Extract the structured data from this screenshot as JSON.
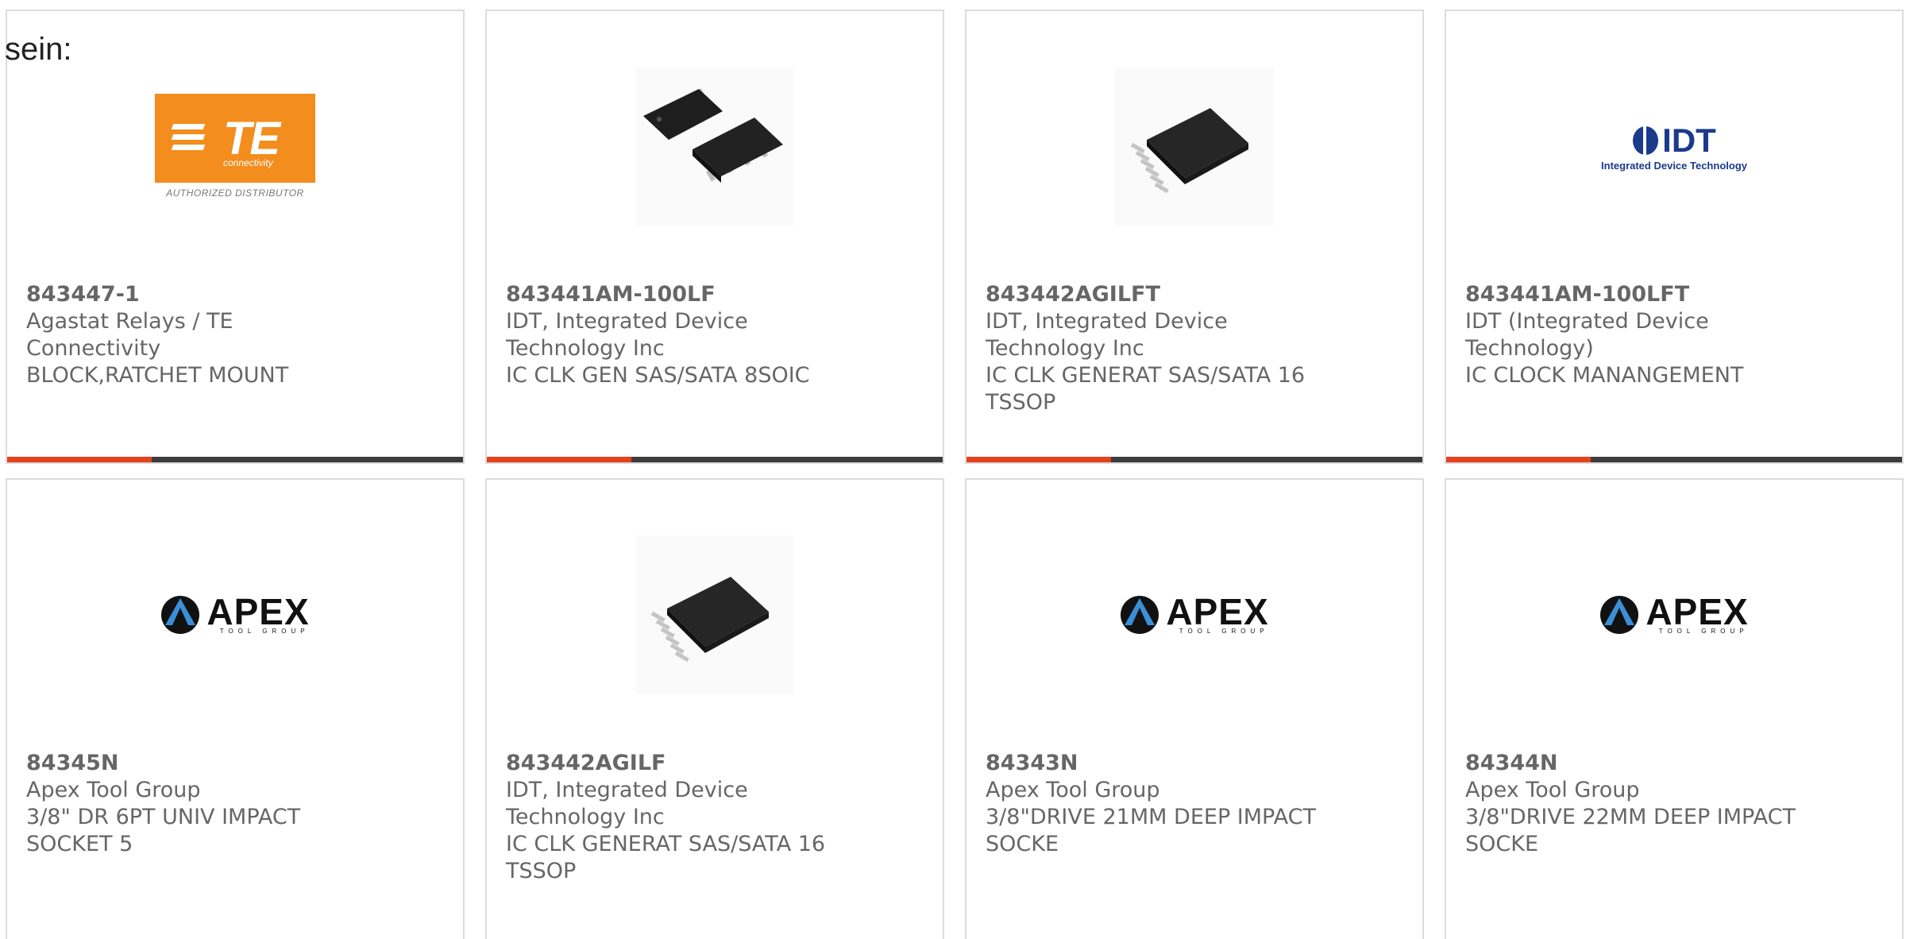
{
  "lead_text": "sein:",
  "cards": [
    {
      "part": "843447-1",
      "maker": "Agastat Relays / TE Connectivity",
      "desc": "BLOCK,RATCHET MOUNT",
      "image": "te-connectivity-logo",
      "logo_main": "TE",
      "logo_sub": "connectivity",
      "logo_caption": "AUTHORIZED DISTRIBUTOR"
    },
    {
      "part": "843441AM-100LF",
      "maker": "IDT, Integrated Device Technology Inc",
      "desc": "IC CLK GEN SAS/SATA 8SOIC",
      "image": "soic-chip-pair"
    },
    {
      "part": "843442AGILFT",
      "maker": "IDT, Integrated Device Technology Inc",
      "desc": "IC CLK GENERAT SAS/SATA 16 TSSOP",
      "image": "tssop-chip"
    },
    {
      "part": "843441AM-100LFT",
      "maker": "IDT (Integrated Device Technology)",
      "desc": "IC CLOCK MANANGEMENT",
      "image": "idt-logo",
      "logo_main": "IDT",
      "logo_sub": "Integrated Device Technology"
    },
    {
      "part": "84345N",
      "maker": "Apex Tool Group",
      "desc": "3/8\" DR 6PT UNIV IMPACT SOCKET 5",
      "image": "apex-logo",
      "logo_main": "APEX",
      "logo_sub": "TOOL GROUP"
    },
    {
      "part": "843442AGILF",
      "maker": "IDT, Integrated Device Technology Inc",
      "desc": "IC CLK GENERAT SAS/SATA 16 TSSOP",
      "image": "tssop-chip"
    },
    {
      "part": "84343N",
      "maker": "Apex Tool Group",
      "desc": "3/8\"DRIVE 21MM DEEP IMPACT SOCKE",
      "image": "apex-logo",
      "logo_main": "APEX",
      "logo_sub": "TOOL GROUP"
    },
    {
      "part": "84344N",
      "maker": "Apex Tool Group",
      "desc": "3/8\"DRIVE 22MM DEEP IMPACT SOCKE",
      "image": "apex-logo",
      "logo_main": "APEX",
      "logo_sub": "TOOL GROUP"
    }
  ],
  "colors": {
    "accent": "#e8411c",
    "bar": "#3c3c3c",
    "text": "#666666",
    "te_orange": "#f28d1e",
    "idt_blue": "#1b3a8c"
  }
}
